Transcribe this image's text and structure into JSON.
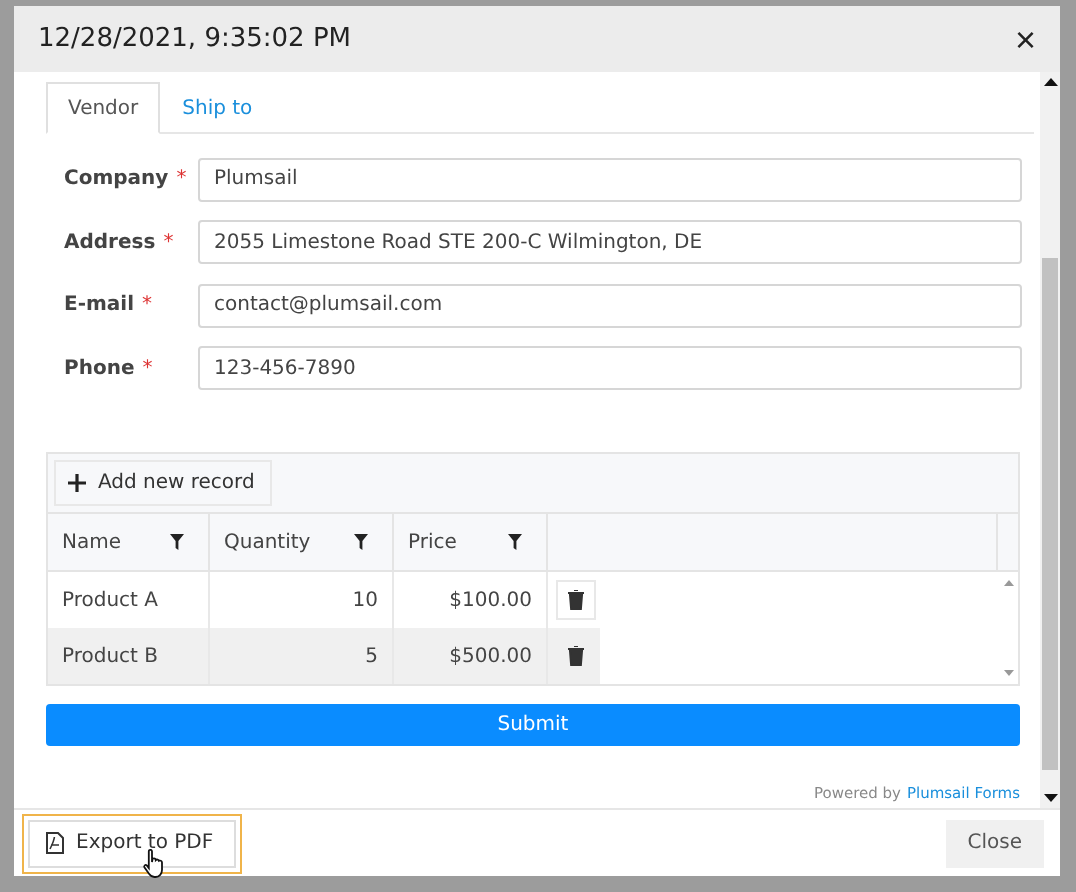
{
  "dialog": {
    "title": "12/28/2021, 9:35:02 PM",
    "close_icon": "×"
  },
  "tabs": [
    {
      "label": "Vendor",
      "selected": true
    },
    {
      "label": "Ship to",
      "selected": false
    }
  ],
  "fields": [
    {
      "label": "Company",
      "required_mark": "*",
      "value": "Plumsail"
    },
    {
      "label": "Address",
      "required_mark": "*",
      "value": "2055 Limestone Road STE 200-C Wilmington, DE"
    },
    {
      "label": "E-mail",
      "required_mark": "*",
      "value": "contact@plumsail.com"
    },
    {
      "label": "Phone",
      "required_mark": "*",
      "value": "123-456-7890"
    }
  ],
  "grid": {
    "toolbar_button": "Add new record",
    "columns": [
      {
        "label": "Name"
      },
      {
        "label": "Quantity"
      },
      {
        "label": "Price"
      }
    ],
    "rows": [
      {
        "cells": [
          "Product A",
          "10",
          "$100.00"
        ],
        "selected": false
      },
      {
        "cells": [
          "Product B",
          "5",
          "$500.00"
        ],
        "selected": true
      }
    ]
  },
  "submit": "Submit",
  "powered_by": {
    "text": "Powered by",
    "link": "Plumsail Forms"
  },
  "footer": {
    "export": {
      "label": "Export to PDF",
      "hovered": true
    },
    "close": "Close"
  }
}
